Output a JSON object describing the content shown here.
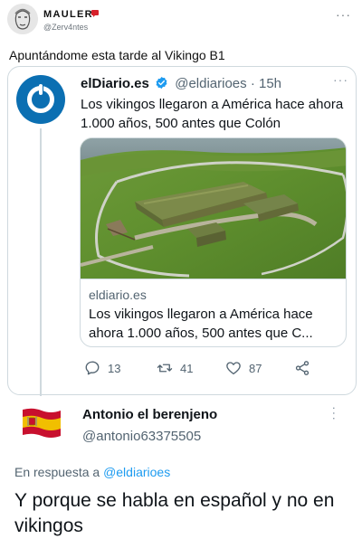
{
  "mauler": {
    "name": "MAULER",
    "handle": "@Zerv4ntes",
    "more_icon": "more-horizontal-icon",
    "text": "Apuntándome esta tarde al Vikingo B1"
  },
  "quoted_tweet": {
    "name": "elDiario.es",
    "handle": "@eldiarioes",
    "separator": "·",
    "time": "15h",
    "verified_color": "#1d9bf0",
    "avatar_color": "#0b6fb2",
    "text": "Los vikingos llegaron a América hace ahora 1.000 años, 500 antes que Colón",
    "link_card": {
      "domain": "eldiario.es",
      "title": "Los vikingos llegaron a América hace ahora 1.000 años, 500 antes que C..."
    },
    "actions": {
      "replies": "13",
      "retweets": "41",
      "likes": "87"
    }
  },
  "reply": {
    "name": "Antonio el berenjeno",
    "handle": "@antonio63375505",
    "avatar": "spain-flag-icon",
    "replying_prefix": "En respuesta a",
    "replying_to": "@eldiarioes",
    "text": "Y porque se habla en español y no en vikingos"
  }
}
